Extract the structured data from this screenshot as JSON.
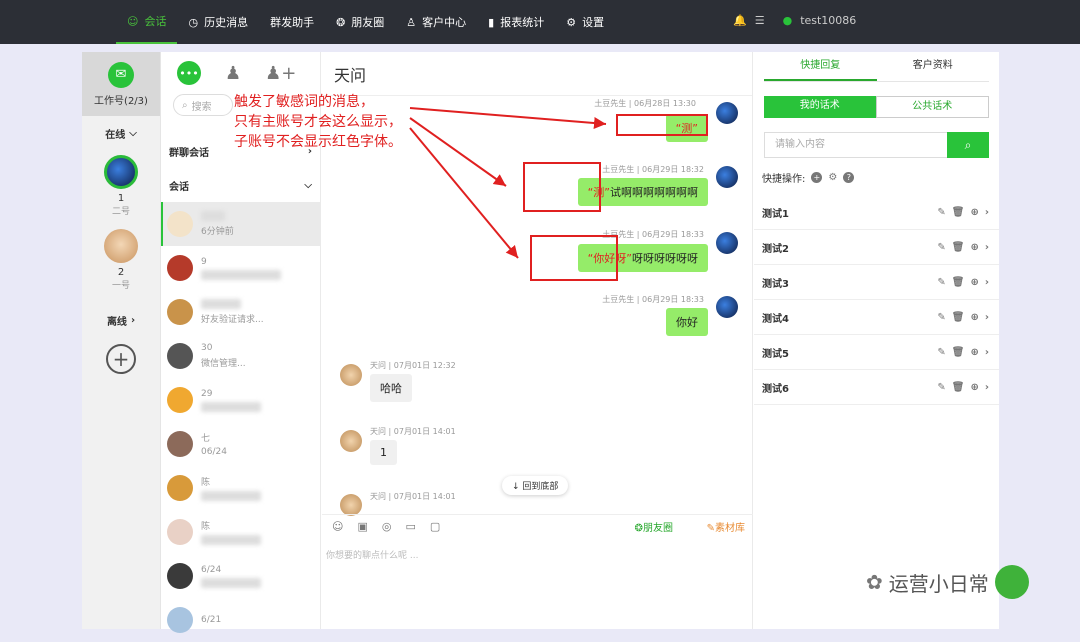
{
  "topnav": {
    "items": [
      {
        "label": "会话",
        "icon": "chat-icon",
        "active": true
      },
      {
        "label": "历史消息",
        "icon": "clock-icon"
      },
      {
        "label": "群发助手",
        "icon": ""
      },
      {
        "label": "朋友圈",
        "icon": "aperture-icon"
      },
      {
        "label": "客户中心",
        "icon": "person-icon"
      },
      {
        "label": "报表统计",
        "icon": "bar-chart-icon"
      },
      {
        "label": "设置",
        "icon": "gear-icon"
      }
    ],
    "username": "test10086"
  },
  "accounts": {
    "work_label": "工作号(2/3)",
    "online_label": "在线",
    "offline_label": "离线",
    "list": [
      {
        "num": "1",
        "name": "二号"
      },
      {
        "num": "2",
        "name": "一号"
      }
    ]
  },
  "conversations": {
    "search_placeholder": "搜索",
    "group_label": "群聊会话",
    "session_label": "会话",
    "rows": [
      {
        "fragment": "6分钟前"
      },
      {
        "fragment": "9"
      },
      {
        "fragment": ""
      },
      {
        "fragment": "好友验证请求..."
      },
      {
        "fragment": "30"
      },
      {
        "fragment": "微信管理..."
      },
      {
        "fragment": "29"
      },
      {
        "fragment": "七"
      },
      {
        "fragment": "06/24"
      },
      {
        "fragment": "陈"
      },
      {
        "fragment": "陈"
      },
      {
        "fragment": "6/24"
      },
      {
        "fragment": "6/21"
      }
    ]
  },
  "chat": {
    "title": "天问",
    "annotation": [
      "触发了敏感词的消息，",
      "只有主账号才会这么显示，",
      "子账号不会显示红色字体。"
    ],
    "messages": [
      {
        "meta": "土豆先生 | 06月28日 13:30",
        "red": "“测”",
        "text": ""
      },
      {
        "meta": "土豆先生 | 06月29日 18:32",
        "red": "“测”",
        "text": "试啊啊啊啊啊啊啊"
      },
      {
        "meta": "土豆先生 | 06月29日 18:33",
        "red": "“你好呀”",
        "text": "呀呀呀呀呀呀"
      },
      {
        "meta": "土豆先生 | 06月29日 18:33",
        "red": "",
        "text": "你好"
      },
      {
        "meta": "天问 | 07月01日 12:32",
        "text": "哈哈"
      },
      {
        "meta": "天问 | 07月01日 14:01",
        "text": "1"
      },
      {
        "meta": "天问 | 07月01日 14:01",
        "text": ""
      }
    ],
    "back_to_bottom": "回到底部",
    "toolbar_moments": "朋友圈",
    "toolbar_material": "素材库",
    "input_placeholder": "你想要的聊点什么呢 ..."
  },
  "quick": {
    "tabs": [
      "快捷回复",
      "客户资料"
    ],
    "seg": [
      "我的话术",
      "公共话术"
    ],
    "search_placeholder": "请输入内容",
    "ops_label": "快捷操作:",
    "items": [
      "测试1",
      "测试2",
      "测试3",
      "测试4",
      "测试5",
      "测试6"
    ]
  },
  "watermark": "运营小日常",
  "colors": {
    "accent": "#29c33a",
    "topbar": "#2c2f36",
    "warn": "#e02020"
  }
}
